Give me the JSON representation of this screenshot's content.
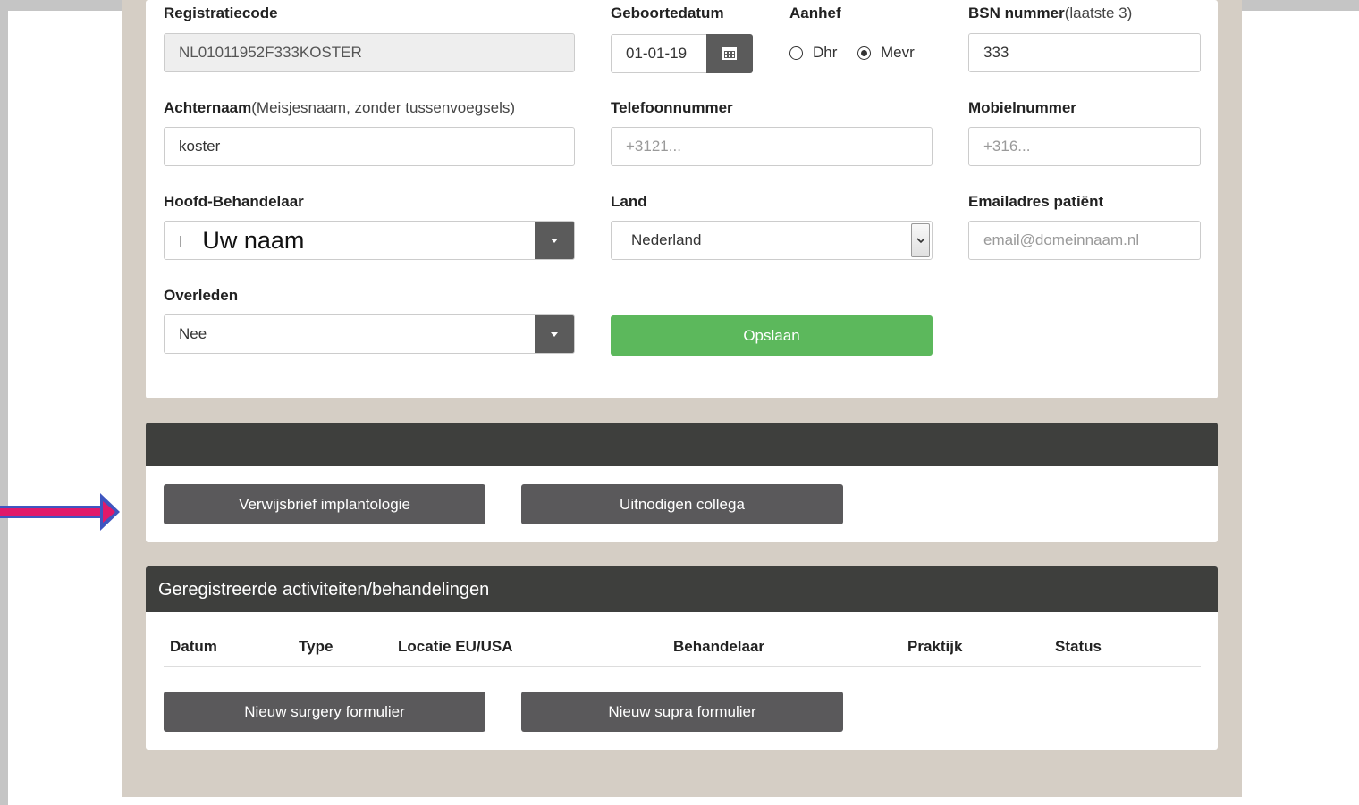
{
  "form": {
    "registratiecode": {
      "label": "Registratiecode",
      "value": "NL01011952F333KOSTER"
    },
    "geboortedatum": {
      "label": "Geboortedatum",
      "value": "01-01-19"
    },
    "aanhef": {
      "label": "Aanhef",
      "options": [
        "Dhr",
        "Mevr"
      ],
      "selected": "Mevr"
    },
    "bsn": {
      "label": "BSN nummer",
      "note": "(laatste 3)",
      "value": "333"
    },
    "achternaam": {
      "label": "Achternaam",
      "note": "(Meisjesnaam, zonder tussenvoegsels)",
      "value": "koster"
    },
    "telefoon": {
      "label": "Telefoonnummer",
      "placeholder": "+3121..."
    },
    "mobiel": {
      "label": "Mobielnummer",
      "placeholder": "+316..."
    },
    "behandelaar": {
      "label": "Hoofd-Behandelaar",
      "value": "Uw naam"
    },
    "land": {
      "label": "Land",
      "value": "Nederland"
    },
    "email": {
      "label": "Emailadres patiënt",
      "placeholder": "email@domeinnaam.nl"
    },
    "overleden": {
      "label": "Overleden",
      "value": "Nee"
    },
    "save_label": "Opslaan"
  },
  "actions": {
    "verwijsbrief_label": "Verwijsbrief implantologie",
    "uitnodigen_label": "Uitnodigen collega"
  },
  "activities": {
    "title": "Geregistreerde activiteiten/behandelingen",
    "columns": [
      "Datum",
      "Type",
      "Locatie EU/USA",
      "Behandelaar",
      "Praktijk",
      "Status"
    ],
    "new_surgery_label": "Nieuw surgery formulier",
    "new_supra_label": "Nieuw supra formulier"
  },
  "colors": {
    "accent_green": "#5cb85c",
    "button_dark": "#5a595b",
    "header_dark": "#3e3f3d",
    "annotation_arrow": "#e0196a"
  }
}
